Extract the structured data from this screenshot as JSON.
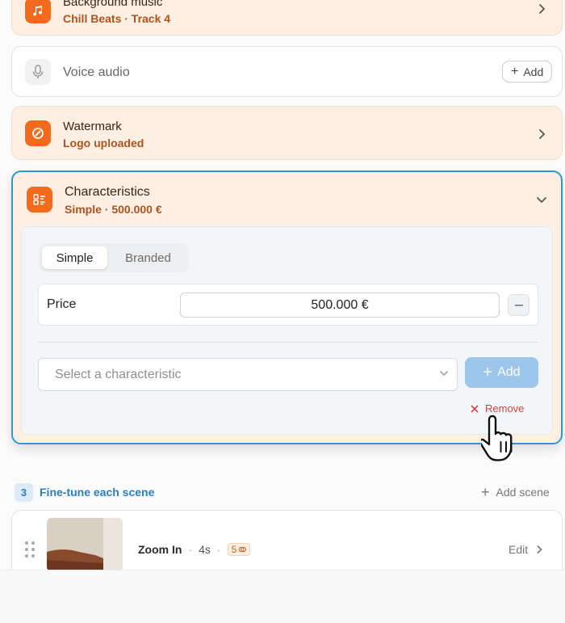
{
  "background_music": {
    "title": "Background music",
    "subtitle": "Chill Beats · Track 4"
  },
  "voice_audio": {
    "title": "Voice audio",
    "add_label": "Add"
  },
  "watermark": {
    "title": "Watermark",
    "subtitle": "Logo uploaded"
  },
  "characteristics": {
    "title": "Characteristics",
    "subtitle": "Simple · 500.000 €",
    "tabs": [
      {
        "label": "Simple",
        "active": true
      },
      {
        "label": "Branded",
        "active": false
      }
    ],
    "price_label": "Price",
    "price_value": "500.000 €",
    "select_placeholder": "Select a characteristic",
    "add_label": "Add",
    "remove_label": "Remove"
  },
  "scenes": {
    "step_number": "3",
    "step_label": "Fine-tune each scene",
    "add_scene_label": "Add scene",
    "items": [
      {
        "effect": "Zoom In",
        "duration": "4s",
        "credits": "5",
        "edit_label": "Edit"
      }
    ]
  },
  "colors": {
    "accent_orange": "#f26a1b",
    "accent_blue": "#2a9ad6",
    "card_tint": "#fdf0e2"
  }
}
